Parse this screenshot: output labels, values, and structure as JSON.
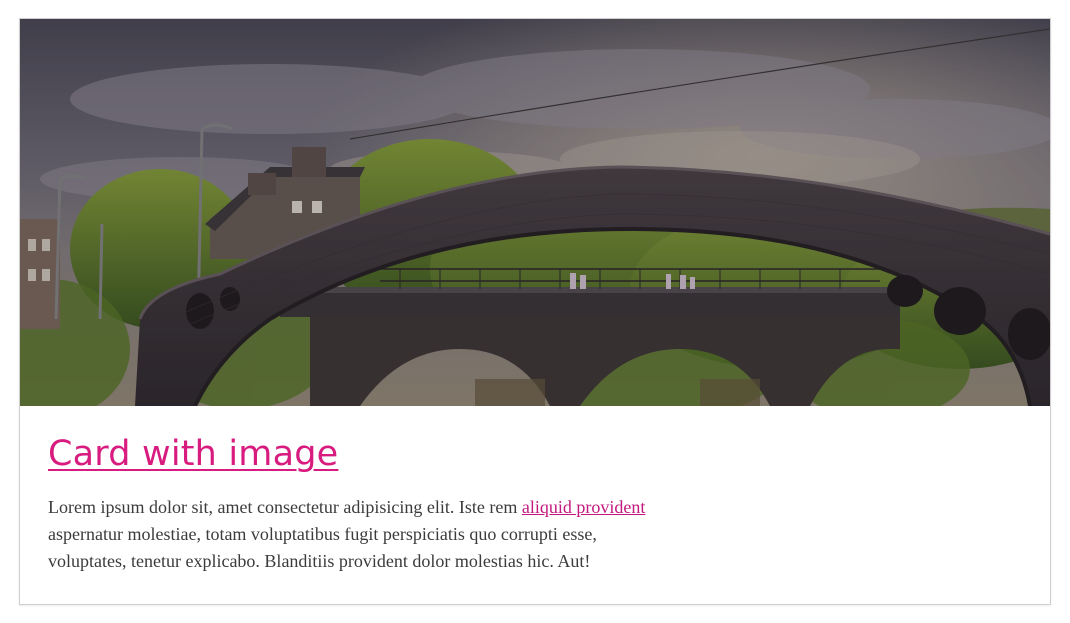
{
  "card": {
    "image_subject": "stone-arch-bridge-over-river-at-sunset",
    "title": "Card with image",
    "text_before_link": "Lorem ipsum dolor sit, amet consectetur adipisicing elit. Iste rem ",
    "link_text": "aliquid provident",
    "text_after_link": " aspernatur molestiae, totam voluptatibus fugit perspiciatis quo corrupti esse, voluptates, tenetur explicabo. Blanditiis provident dolor molestias hic. Aut!"
  },
  "colors": {
    "accent": "#d81b7f",
    "body_text": "#3b3b3b",
    "border": "#cfcfcf"
  }
}
